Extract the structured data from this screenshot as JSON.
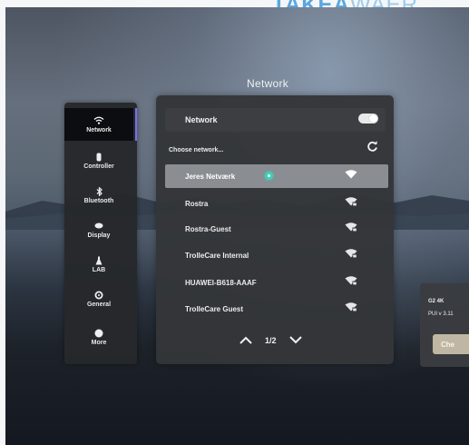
{
  "brand": {
    "bold": "TAKEA",
    "light": "WAER"
  },
  "window_title": "Network",
  "sidebar": {
    "items": [
      {
        "label": "Network",
        "icon": "wifi-icon",
        "active": true
      },
      {
        "label": "Controller",
        "icon": "controller-icon"
      },
      {
        "label": "Bluetooth",
        "icon": "bluetooth-icon"
      },
      {
        "label": "Display",
        "icon": "display-icon"
      },
      {
        "label": "LAB",
        "icon": "lab-icon"
      },
      {
        "label": "General",
        "icon": "gear-icon"
      },
      {
        "label": "More",
        "icon": "more-icon"
      }
    ]
  },
  "network_panel": {
    "toggle_label": "Network",
    "toggle_on": true,
    "choose_label": "Choose network...",
    "refresh_icon": "refresh-icon",
    "networks": [
      {
        "ssid": "Jeres Netværk",
        "selected": true,
        "connected": true,
        "locked": false
      },
      {
        "ssid": "Rostra",
        "selected": false,
        "locked": true
      },
      {
        "ssid": "Rostra-Guest",
        "selected": false,
        "locked": true
      },
      {
        "ssid": "TrolleCare Internal",
        "selected": false,
        "locked": true
      },
      {
        "ssid": "HUAWEI-B618-AAAF",
        "selected": false,
        "locked": true
      },
      {
        "ssid": "TrolleCare Guest",
        "selected": false,
        "locked": true
      }
    ],
    "pager": {
      "current": "1",
      "separator": "/",
      "total": "2",
      "text": "1/2"
    }
  },
  "device_card": {
    "model": "G2 4K",
    "version": "PUI v 3.11",
    "button_label": "Che"
  },
  "colors": {
    "accent": "#7b6cf0",
    "connected": "#3ed1b6",
    "panel_bg": "#343639",
    "selected_row": "#8a8d92",
    "brand": "#5aa7e0"
  }
}
